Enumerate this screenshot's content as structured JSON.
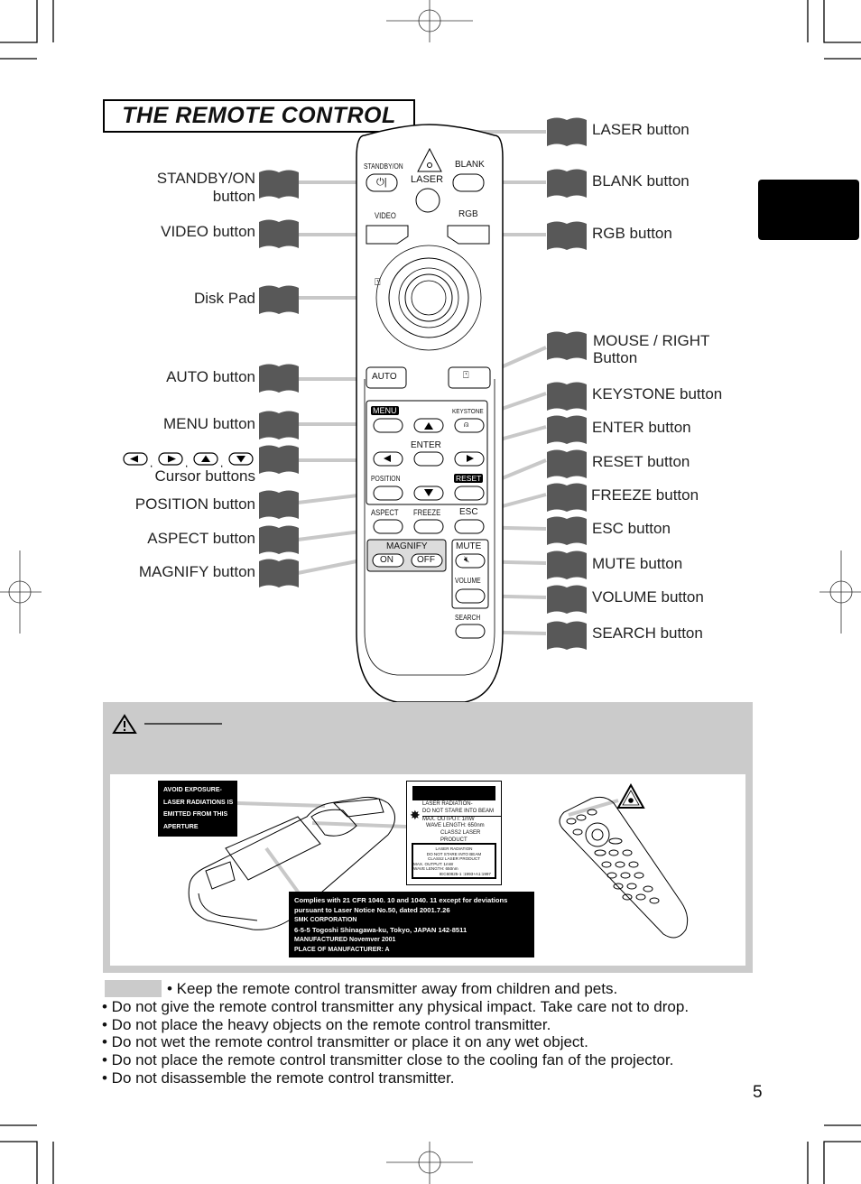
{
  "page": {
    "title": "THE REMOTE CONTROL",
    "page_number": "5"
  },
  "left_labels": [
    {
      "text": "STANDBY/ON",
      "text2": "button"
    },
    {
      "text": "VIDEO button"
    },
    {
      "text": "Disk Pad"
    },
    {
      "text": "AUTO button"
    },
    {
      "text": "MENU button"
    },
    {
      "text": "Cursor buttons"
    },
    {
      "text": "POSITION button"
    },
    {
      "text": "ASPECT button"
    },
    {
      "text": "MAGNIFY button"
    }
  ],
  "right_labels": [
    {
      "text": "LASER button"
    },
    {
      "text": "BLANK button"
    },
    {
      "text": "RGB button"
    },
    {
      "text": "MOUSE / RIGHT",
      "text2": "Button"
    },
    {
      "text": "KEYSTONE button"
    },
    {
      "text": "ENTER button"
    },
    {
      "text": "RESET button"
    },
    {
      "text": "FREEZE button"
    },
    {
      "text": "ESC button"
    },
    {
      "text": "MUTE button"
    },
    {
      "text": "VOLUME button"
    },
    {
      "text": "SEARCH button"
    }
  ],
  "cursor_separator": ",",
  "remote": {
    "standby": "STANDBY/ON",
    "laser": "LASER",
    "blank": "BLANK",
    "video": "VIDEO",
    "rgb": "RGB",
    "auto": "AUTO",
    "menu": "MENU",
    "keystone": "KEYSTONE",
    "enter": "ENTER",
    "position": "POSITION",
    "reset": "RESET",
    "aspect": "ASPECT",
    "freeze": "FREEZE",
    "esc": "ESC",
    "magnify": "MAGNIFY",
    "on": "ON",
    "off": "OFF",
    "mute": "MUTE",
    "volume": "VOLUME",
    "search": "SEARCH"
  },
  "caution": {
    "aperture_label": [
      "AVOID  EXPOSURE-",
      "LASER RADIATIONS IS",
      "EMITTED   FROM   THIS",
      "APERTURE"
    ],
    "laser_label_top": [
      "LASER  RADIATION-",
      "DO NOT STARE INTO BEAM",
      "MAX. OUTPUT:  1mW",
      "WAVE LENGTH:   650nm",
      "CLASS2 LASER PRODUCT"
    ],
    "laser_label_bottom": [
      "LASER RADIATION",
      "DO NOT STARE INTO BEAM",
      "CLASS2 LASER PRODUCT",
      "MAX.  OUTPUT:  1mW",
      "WAVE LENGTH:  650nm",
      "IEC60825-1 :1993+A1:1997"
    ],
    "compliance": [
      "Complies with 21 CFR 1040. 10 and 1040. 11 except for deviations",
      "pursuant  to  Laser  Notice  No.50,  dated  2001.7.26",
      "SMK CORPORATION",
      "6-5-5  Togoshi  Shinagawa-ku,  Tokyo,  JAPAN 142-8511",
      "MANUFACTURED   Novemver  2001",
      "PLACE  OF  MANUFACTURER:  A"
    ]
  },
  "notes": [
    "• Keep the remote control transmitter away from children and pets.",
    "• Do not give the remote control transmitter any physical impact. Take care not to drop.",
    "• Do not place the heavy objects on the remote control transmitter.",
    "• Do not wet the remote control transmitter or place it on any wet object.",
    "• Do not place the remote control transmitter close to the cooling fan of the projector.",
    "• Do not disassemble the remote control transmitter."
  ],
  "colors": {
    "book_icon": "#585858",
    "leader_line": "#c8c8c8",
    "caution_bg": "#cbcbcb",
    "side_tab": "#000000"
  }
}
